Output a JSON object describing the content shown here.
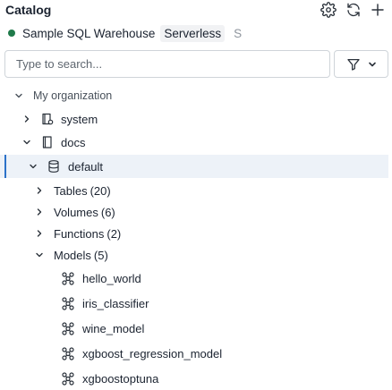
{
  "header": {
    "title": "Catalog"
  },
  "warehouse": {
    "name": "Sample SQL Warehouse",
    "badge": "Serverless",
    "extra": "S",
    "status_color": "#1f7a4a"
  },
  "search": {
    "placeholder": "Type to search..."
  },
  "tree": {
    "org": {
      "label": "My organization",
      "expanded": true
    },
    "system": {
      "label": "system",
      "expanded": false
    },
    "docs": {
      "label": "docs",
      "expanded": true
    },
    "default": {
      "label": "default",
      "expanded": true,
      "selected": true
    },
    "tables": {
      "label": "Tables",
      "count": "(20)"
    },
    "volumes": {
      "label": "Volumes",
      "count": "(6)"
    },
    "functions": {
      "label": "Functions",
      "count": "(2)"
    },
    "models": {
      "label": "Models",
      "count": "(5)",
      "expanded": true
    },
    "model_items": [
      {
        "label": "hello_world"
      },
      {
        "label": "iris_classifier"
      },
      {
        "label": "wine_model"
      },
      {
        "label": "xgboost_regression_model"
      },
      {
        "label": "xgboostoptuna"
      }
    ]
  },
  "icons": {
    "gear": "gear-icon",
    "refresh": "refresh-icon",
    "add": "plus-icon",
    "filter": "filter-icon",
    "catalog": "catalog-icon",
    "schema": "database-icon",
    "model": "model-icon",
    "chevron_right": "chevron-right-icon",
    "chevron_down": "chevron-down-icon"
  },
  "colors": {
    "selection_bar": "#2c72c9",
    "selection_bg": "#edf2f8"
  }
}
